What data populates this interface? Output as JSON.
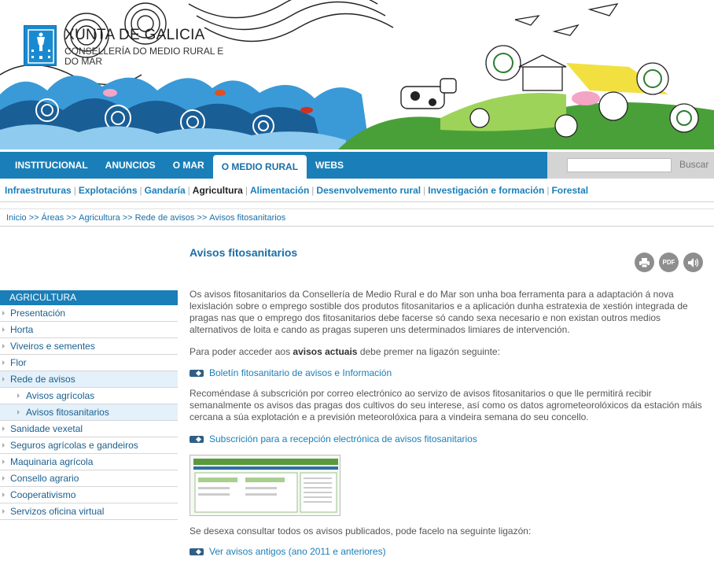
{
  "header": {
    "logo_title": "XUNTA DE GALICIA",
    "logo_subtitle": "CONSELLERÍA DO MEDIO RURAL E DO MAR"
  },
  "main_nav": [
    {
      "label": "INSTITUCIONAL",
      "active": false
    },
    {
      "label": "ANUNCIOS",
      "active": false
    },
    {
      "label": "O MAR",
      "active": false
    },
    {
      "label": "O MEDIO RURAL",
      "active": true
    },
    {
      "label": "WEBS",
      "active": false
    }
  ],
  "search": {
    "placeholder": "",
    "button_label": "Buscar"
  },
  "sub_nav": [
    {
      "label": "Infraestruturas",
      "current": false
    },
    {
      "label": "Explotacións",
      "current": false
    },
    {
      "label": "Gandaría",
      "current": false
    },
    {
      "label": "Agricultura",
      "current": true
    },
    {
      "label": "Alimentación",
      "current": false
    },
    {
      "label": "Desenvolvemento rural",
      "current": false
    },
    {
      "label": "Investigación e formación",
      "current": false
    },
    {
      "label": "Forestal",
      "current": false
    }
  ],
  "breadcrumb": [
    "Inicio",
    "Áreas",
    "Agricultura",
    "Rede de avisos",
    "Avisos fitosanitarios"
  ],
  "breadcrumb_separator": ">>",
  "sidebar": {
    "heading": "AGRICULTURA",
    "items": [
      {
        "label": "Presentación",
        "level": 1,
        "active": false
      },
      {
        "label": "Horta",
        "level": 1,
        "active": false
      },
      {
        "label": "Viveiros e sementes",
        "level": 1,
        "active": false
      },
      {
        "label": "Flor",
        "level": 1,
        "active": false
      },
      {
        "label": "Rede de avisos",
        "level": 1,
        "active": true
      },
      {
        "label": "Avisos agrícolas",
        "level": 2,
        "active": false
      },
      {
        "label": "Avisos fitosanitarios",
        "level": 2,
        "active": true
      },
      {
        "label": "Sanidade vexetal",
        "level": 1,
        "active": false
      },
      {
        "label": "Seguros agrícolas e gandeiros",
        "level": 1,
        "active": false
      },
      {
        "label": "Maquinaria agrícola",
        "level": 1,
        "active": false
      },
      {
        "label": "Consello agrario",
        "level": 1,
        "active": false
      },
      {
        "label": "Cooperativismo",
        "level": 1,
        "active": false
      },
      {
        "label": "Servizos oficina virtual",
        "level": 1,
        "active": false
      }
    ]
  },
  "content": {
    "title": "Avisos fitosanitarios",
    "tools": [
      "printer-icon",
      "pdf-icon",
      "audio-icon"
    ],
    "tool_labels": {
      "pdf": "PDF"
    },
    "intro": "Os avisos fitosanitarios da Consellería de Medio Rural e do Mar son unha boa ferramenta para a adaptación á nova lexislación sobre o emprego sostible dos produtos fitosanitarios e a aplicación dunha estratexia de xestión integrada de pragas nas que o emprego dos fitosanitarios debe facerse só cando sexa necesario e non existan outros medios alternativos de loita e cando as pragas superen uns determinados limiares de intervención.",
    "access_before": "Para poder acceder aos ",
    "access_bold": "avisos actuais",
    "access_after": " debe premer na ligazón seguinte:",
    "link1": "Boletín fitosanitario de avisos e Información",
    "recommend": "Recoméndase á subscrición por correo electrónico ao servizo de avisos fitosanitarios o que lle permitirá recibir semanalmente os avisos das pragas dos cultivos do seu interese, así como os datos agrometeorolóxicos da estación máis cercana a súa explotación e a previsión meteorolóxica para a vindeira semana do seu concello.",
    "link2": "Subscrición para a recepción electrónica de avisos fitosanitarios",
    "consult": "Se desexa consultar todos os avisos publicados, pode facelo na seguinte ligazón:",
    "link3": "Ver avisos antigos (ano 2011 e anteriores)"
  },
  "colors": {
    "accent": "#1a7fb8",
    "active_bg": "#e4f1fa",
    "text": "#555555"
  }
}
